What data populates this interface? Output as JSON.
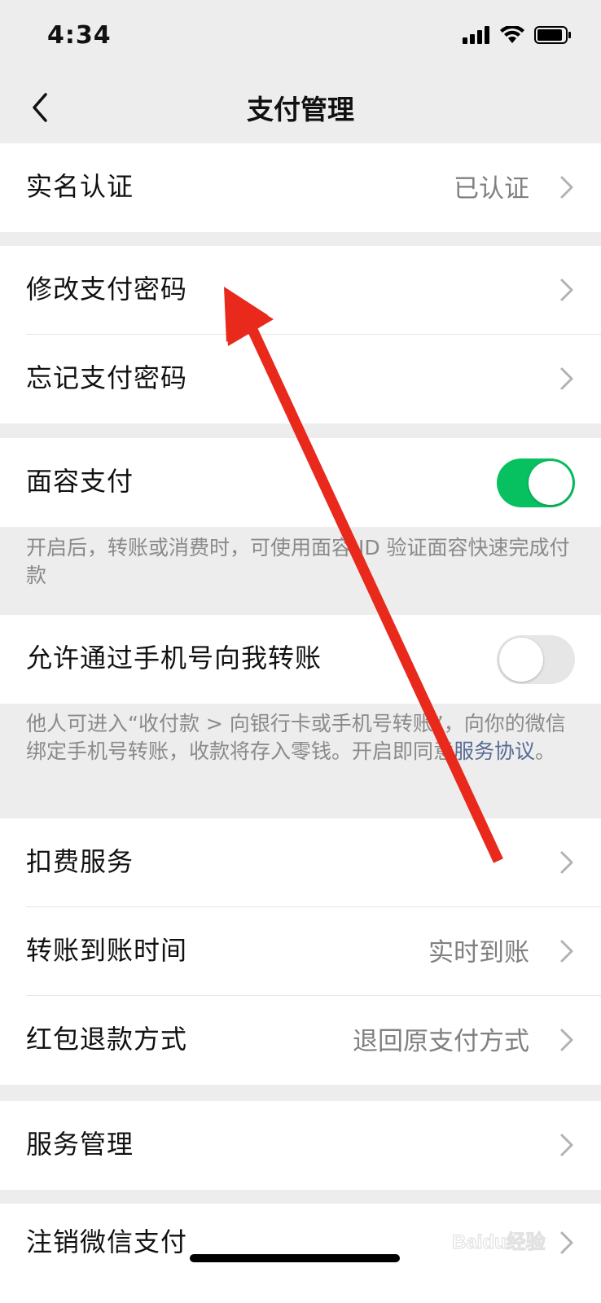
{
  "status_bar": {
    "time": "4:34"
  },
  "nav": {
    "title": "支付管理"
  },
  "rows": {
    "real_name": {
      "label": "实名认证",
      "value": "已认证"
    },
    "change_password": {
      "label": "修改支付密码"
    },
    "forgot_password": {
      "label": "忘记支付密码"
    },
    "face_pay": {
      "label": "面容支付",
      "enabled": true
    },
    "phone_transfer": {
      "label": "允许通过手机号向我转账",
      "enabled": false
    },
    "deduction": {
      "label": "扣费服务"
    },
    "arrival_time": {
      "label": "转账到账时间",
      "value": "实时到账"
    },
    "red_packet_refund": {
      "label": "红包退款方式",
      "value": "退回原支付方式"
    },
    "service_mgmt": {
      "label": "服务管理"
    },
    "cancel_pay": {
      "label": "注销微信支付"
    }
  },
  "notes": {
    "face_pay": "开启后，转账或消费时，可使用面容 ID 验证面容快速完成付款",
    "phone_transfer_text": "他人可进入“收付款 > 向银行卡或手机号转账”，向你的微信绑定手机号转账，收款将存入零钱。开启即同意",
    "phone_transfer_link": "服务协议",
    "phone_transfer_end": "。"
  },
  "colors": {
    "toggle_on": "#07c160",
    "link": "#576b95",
    "annotation_arrow": "#e8291c"
  },
  "icons": [
    "signal-icon",
    "wifi-icon",
    "battery-icon",
    "back-chevron-icon",
    "chevron-right-icon"
  ],
  "watermark": "Baidu经验"
}
